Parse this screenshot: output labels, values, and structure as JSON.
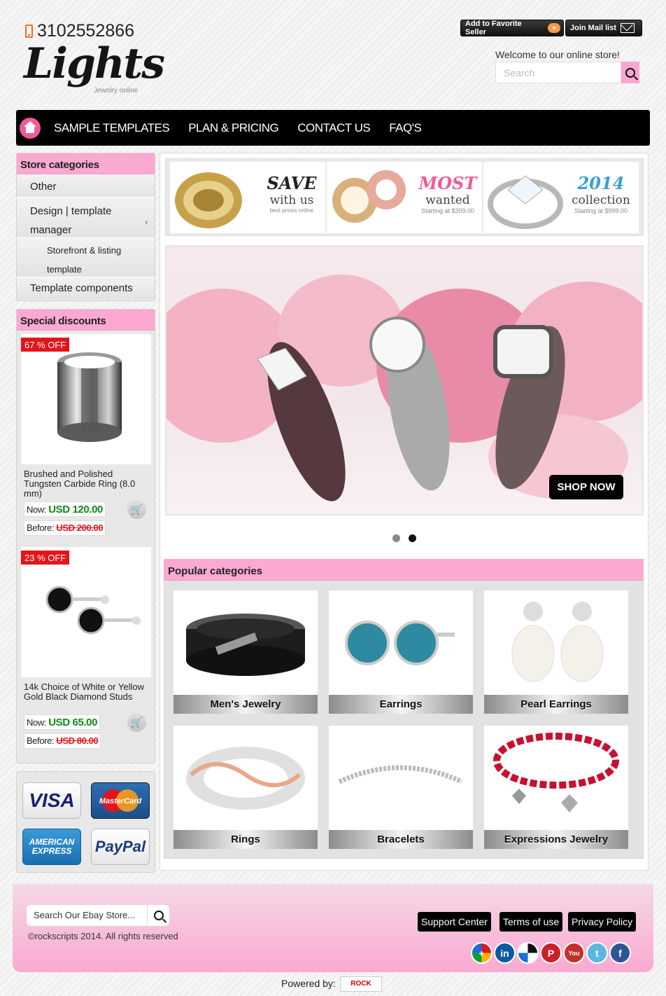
{
  "header": {
    "phone": "3102552866",
    "logo": "Lights",
    "logo_sub": "Jewelry online",
    "fav_btn": "Add to Favorite Seller",
    "mail_btn": "Join Mail list",
    "welcome": "Welcome to our online store!",
    "search_placeholder": "Search"
  },
  "nav": {
    "items": [
      "SAMPLE TEMPLATES",
      "PLAN & PRICING",
      "CONTACT US",
      "FAQ'S"
    ]
  },
  "sidebar": {
    "categories_title": "Store categories",
    "categories": [
      "Other",
      "Design | template manager",
      "Storefront & listing template",
      "Template components"
    ],
    "discounts_title": "Special discounts",
    "products": [
      {
        "badge": "67 % OFF",
        "name": "Brushed and Polished Tungsten Carbide Ring (8.0 mm)",
        "now_label": "Now:",
        "now": "USD 120.00",
        "before_label": "Before:",
        "before": "USD 200.00"
      },
      {
        "badge": "23 % OFF",
        "name": "14k Choice of White or Yellow Gold Black Diamond Studs",
        "now_label": "Now:",
        "now": "USD 65.00",
        "before_label": "Before:",
        "before": "USD 80.00"
      }
    ],
    "payments": [
      "VISA",
      "MasterCard",
      "AMERICAN EXPRESS",
      "PayPal"
    ]
  },
  "banners": [
    {
      "title": "SAVE",
      "line2": "with us",
      "line3": "best prices online",
      "color": "#555555"
    },
    {
      "title": "MOST",
      "line2": "wanted",
      "line3": "Starting at $399.00",
      "color": "#f05a9a"
    },
    {
      "title": "2014",
      "line2": "collection",
      "line3": "Starting at $999.00",
      "color": "#3aa0d8"
    }
  ],
  "slider": {
    "cta": "SHOP NOW"
  },
  "popular": {
    "title": "Popular categories",
    "items": [
      "Men's Jewelry",
      "Earrings",
      "Pearl Earrings",
      "Rings",
      "Bracelets",
      "Expressions Jewelry"
    ]
  },
  "footer": {
    "search_placeholder": "Search Our Ebay Store...",
    "copyright": "©rockscripts 2014. All rights reserved",
    "links": [
      "Support Center",
      "Terms of use",
      "Privacy Policy"
    ],
    "powered": "Powered by:",
    "powered_logo": "ROCK"
  },
  "colors": {
    "accent": "#fba8d3",
    "nav": "#000000",
    "price_now": "#0d8a1a",
    "price_before": "#e3141b"
  }
}
